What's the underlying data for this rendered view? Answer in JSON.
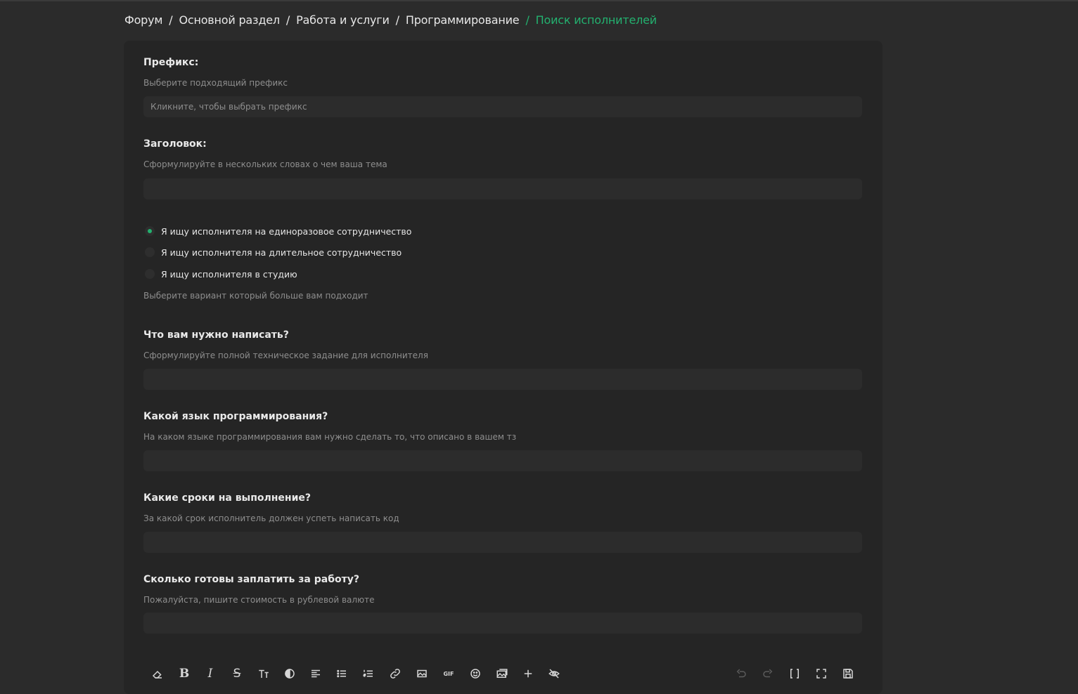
{
  "breadcrumb": {
    "items": [
      "Форум",
      "Основной раздел",
      "Работа и услуги",
      "Программирование"
    ],
    "current": "Поиск исполнителей",
    "separator": "/"
  },
  "form": {
    "prefix": {
      "label": "Префикс:",
      "hint": "Выберите подходящий префикс",
      "placeholder": "Кликните, чтобы выбрать префикс"
    },
    "title": {
      "label": "Заголовок:",
      "hint": "Сформулируйте в нескольких словах о чем ваша тема",
      "value": ""
    },
    "cooperation": {
      "options": [
        "Я ищу исполнителя на единоразовое сотрудничество",
        "Я ищу исполнителя на длительное сотрудничество",
        "Я ищу исполнителя в студию"
      ],
      "selected_index": 0,
      "hint": "Выберите вариант который больше вам подходит"
    },
    "task": {
      "label": "Что вам нужно написать?",
      "hint": "Сформулируйте полной техническое задание для исполнителя",
      "value": ""
    },
    "language": {
      "label": "Какой язык программирования?",
      "hint": "На каком языке программирования вам нужно сделать то, что описано в вашем тз",
      "value": ""
    },
    "deadline": {
      "label": "Какие сроки на выполнение?",
      "hint": "За какой срок исполнитель должен успеть написать код",
      "value": ""
    },
    "budget": {
      "label": "Сколько готовы заплатить за работу?",
      "hint": "Пожалуйста, пишите стоимость в рублевой валюте",
      "value": ""
    }
  },
  "toolbar": {
    "left": [
      "eraser-icon",
      "bold-icon",
      "italic-icon",
      "strikethrough-icon",
      "text-size-icon",
      "color-icon",
      "align-icon",
      "bullet-list-icon",
      "numbered-list-icon",
      "link-icon",
      "image-icon",
      "gif-icon",
      "smile-icon",
      "media-icon",
      "insert-icon",
      "hide-icon"
    ],
    "right": [
      "undo-icon",
      "redo-icon",
      "bbcode-toggle-icon",
      "fullscreen-icon",
      "save-draft-icon"
    ],
    "gif_label": "GIF"
  },
  "colors": {
    "accent": "#23b16f",
    "page_bg": "#2b2b2b",
    "card_bg": "#252525",
    "input_bg": "#2c2c2c"
  }
}
